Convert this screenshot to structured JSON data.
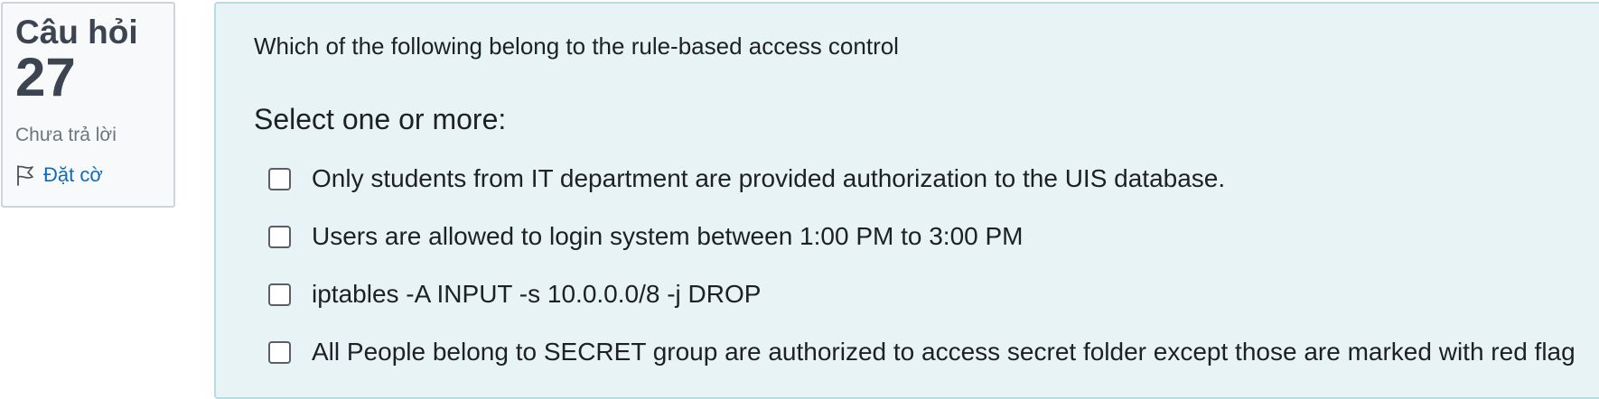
{
  "info": {
    "question_word": "Câu hỏi",
    "question_number": "27",
    "state": "Chưa trả lời",
    "flag_label": "Đặt cờ",
    "flag_icon": "flag-icon"
  },
  "question": {
    "text": "Which of the following belong to the rule-based access control",
    "prompt": "Select one or more:",
    "answers": [
      {
        "label": "Only students from IT department are provided authorization to the UIS database.",
        "checked": false
      },
      {
        "label": "Users are allowed to login system between 1:00 PM to 3:00 PM",
        "checked": false
      },
      {
        "label": "iptables -A INPUT -s 10.0.0.0/8 -j DROP",
        "checked": false
      },
      {
        "label": "All People belong to SECRET group are authorized to access secret folder except those are marked with red flag",
        "checked": false
      }
    ]
  },
  "colors": {
    "info_bg": "#f8f9fa",
    "content_bg": "#e7f3f5",
    "link": "#0f6cbf",
    "text": "#1d2125"
  }
}
